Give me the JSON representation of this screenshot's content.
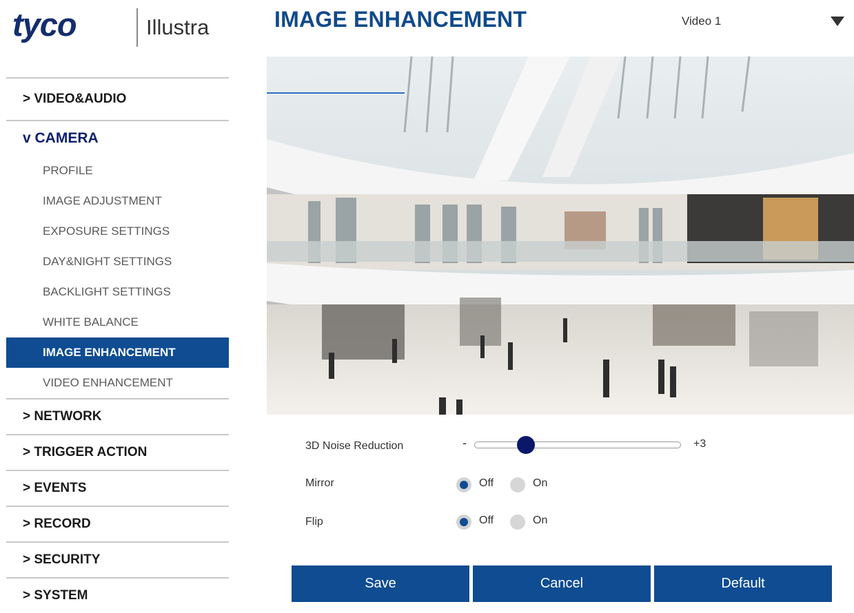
{
  "logo": {
    "brand": "tyco",
    "product": "Illustra"
  },
  "sidebar": {
    "sections_top": [
      {
        "label": "> VIDEO&AUDIO"
      }
    ],
    "camera": {
      "label": "v CAMERA",
      "items": [
        {
          "label": "PROFILE"
        },
        {
          "label": "IMAGE ADJUSTMENT"
        },
        {
          "label": "EXPOSURE SETTINGS"
        },
        {
          "label": "DAY&NIGHT SETTINGS"
        },
        {
          "label": "BACKLIGHT SETTINGS"
        },
        {
          "label": "WHITE BALANCE"
        },
        {
          "label": "IMAGE ENHANCEMENT",
          "active": true
        },
        {
          "label": "VIDEO ENHANCEMENT"
        }
      ]
    },
    "sections_bottom": [
      {
        "label": "> NETWORK"
      },
      {
        "label": "> TRIGGER ACTION"
      },
      {
        "label": "> EVENTS"
      },
      {
        "label": "> RECORD"
      },
      {
        "label": "> SECURITY"
      },
      {
        "label": "> SYSTEM"
      }
    ]
  },
  "header": {
    "title": "IMAGE ENHANCEMENT",
    "video_select": "Video 1"
  },
  "controls": {
    "noise_reduction": {
      "label": "3D Noise Reduction",
      "min_symbol": "-",
      "value_text": "+3",
      "value_fraction": 0.25
    },
    "mirror": {
      "label": "Mirror",
      "options": [
        "Off",
        "On"
      ],
      "selected": "Off"
    },
    "flip": {
      "label": "Flip",
      "options": [
        "Off",
        "On"
      ],
      "selected": "Off"
    }
  },
  "buttons": {
    "save": "Save",
    "cancel": "Cancel",
    "default": "Default"
  },
  "colors": {
    "brand_blue": "#0f4c92",
    "slider_thumb": "#0b1769",
    "logo_navy": "#142d6e"
  }
}
